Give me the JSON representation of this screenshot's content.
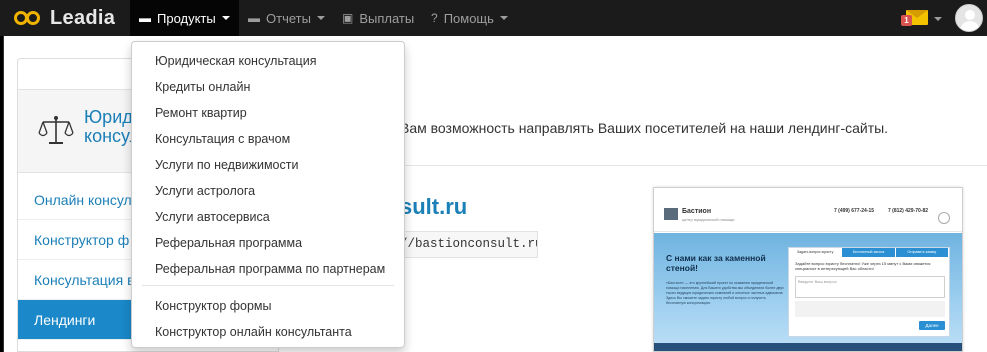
{
  "navbar": {
    "brand": "Leadia",
    "items": [
      {
        "label": "Продукты",
        "icon": "products-icon"
      },
      {
        "label": "Отчеты",
        "icon": "reports-icon"
      },
      {
        "label": "Выплаты",
        "icon": "payments-icon"
      },
      {
        "label": "Помощь",
        "icon": "help-icon"
      }
    ],
    "mail_badge": "1"
  },
  "products_menu": {
    "group1": [
      "Юридическая консультация",
      "Кредиты онлайн",
      "Ремонт квартир",
      "Консультация с врачом",
      "Услуги по недвижимости",
      "Услуги астролога",
      "Услуги автосервиса",
      "Реферальная программа",
      "Реферальная программа по партнерам"
    ],
    "group2": [
      "Конструктор формы",
      "Конструктор онлайн консультанта"
    ]
  },
  "sidebar": {
    "title_line1": "Юрид",
    "title_line2": "консул",
    "items": [
      {
        "label": "Онлайн консул"
      },
      {
        "label": "Конструктор ф"
      },
      {
        "label": "Консультация в"
      },
      {
        "label": "Лендинги"
      }
    ]
  },
  "main": {
    "lead_text": "Вам возможность направлять Ваших посетителей на наши лендинг-сайты.",
    "site_title": "sult.ru",
    "site_url": "//bastionconsult.ru"
  },
  "preview": {
    "brand": "Бастион",
    "brand_sub": "центр юридической помощи",
    "phone1": "7 (499) 677-24-15",
    "phone2": "7 (812) 429-70-82",
    "hero": "С нами как за каменной стеной!",
    "hero_text": "«Бастион» — это крупнейший проект по оказанию юридической помощи населению. Для Вашего удобства мы объединили более двух тысяч ведущих юридических компаний и опытных частных адвокатов. Здесь Вы сможете задать юристу любой вопрос и получить бесплатную консультацию.",
    "tabs": [
      "Задать вопрос юристу",
      "Бесплатный звонок",
      "Отправить заявку"
    ],
    "question": "Задайте вопрос юристу бесплатно! Уже через 15 минут с Вами свяжется специалист в интересующей Вас области!",
    "textarea_placeholder": "Введите Ваш вопрос",
    "button": "Далее"
  },
  "colors": {
    "navbar": "#1b1b1b",
    "link": "#1b7fb8",
    "active": "#1a88c9",
    "brand_logo": "#f0b400"
  }
}
